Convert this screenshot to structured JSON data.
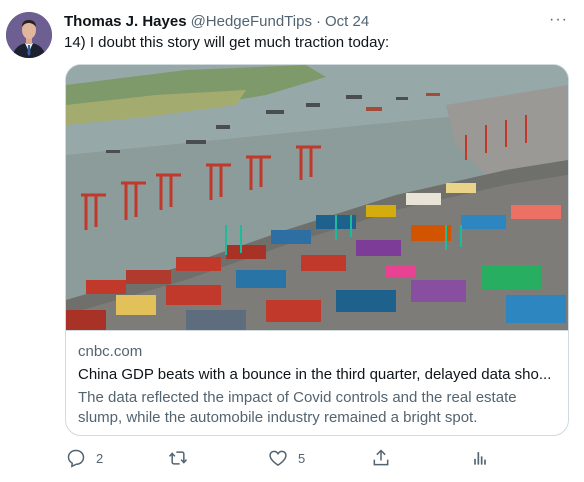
{
  "tweet": {
    "display_name": "Thomas J. Hayes",
    "handle": "@HedgeFundTips",
    "separator": "·",
    "date": "Oct 24",
    "more_glyph": "···",
    "text": "14) I doubt this story will get much traction today:"
  },
  "card": {
    "domain": "cnbc.com",
    "title": "China GDP beats with a bounce in the third quarter, delayed data sho...",
    "description": "The data reflected the impact of Covid controls and the real estate slump, while the automobile industry remained a bright spot."
  },
  "actions": {
    "replies": "2",
    "retweets": "",
    "likes": "5"
  },
  "colors": {
    "text_primary": "#0f1419",
    "text_secondary": "#536471",
    "border": "#cfd9de"
  },
  "icons": [
    "reply-icon",
    "retweet-icon",
    "like-icon",
    "share-icon",
    "analytics-icon",
    "more-icon"
  ]
}
